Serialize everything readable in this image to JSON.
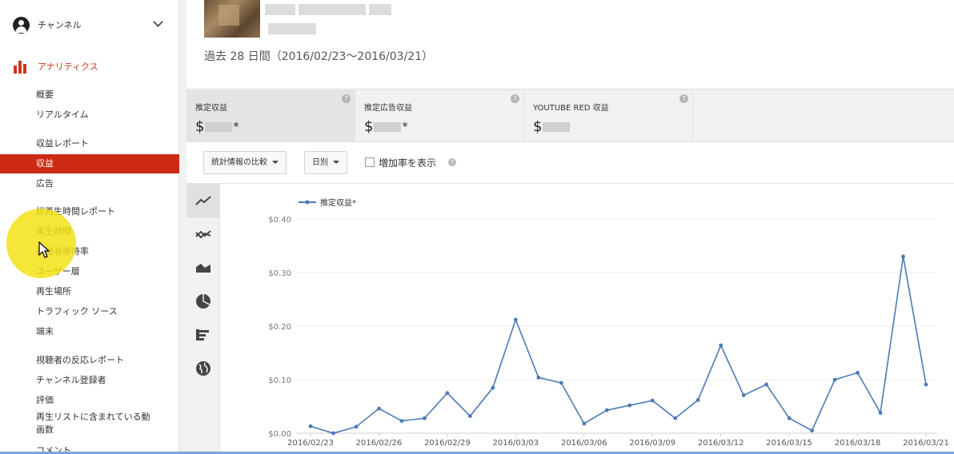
{
  "sidebar": {
    "channel_label": "チャンネル",
    "analytics_label": "アナリティクス",
    "items": [
      {
        "label": "概要",
        "name": "sidebar-item-overview"
      },
      {
        "label": "リアルタイム",
        "name": "sidebar-item-realtime"
      },
      {
        "label": "収益レポート",
        "name": "sidebar-item-revenue-reports"
      },
      {
        "label": "収益",
        "name": "sidebar-item-revenue"
      },
      {
        "label": "広告",
        "name": "sidebar-item-ads"
      },
      {
        "label": "総再生時間レポート",
        "name": "sidebar-item-watch-time-reports"
      },
      {
        "label": "再生時間",
        "name": "sidebar-item-watch-time"
      },
      {
        "label": "視聴者維持率",
        "name": "sidebar-item-audience-retention"
      },
      {
        "label": "ユーザー層",
        "name": "sidebar-item-demographics"
      },
      {
        "label": "再生場所",
        "name": "sidebar-item-playback-locations"
      },
      {
        "label": "トラフィック ソース",
        "name": "sidebar-item-traffic-sources"
      },
      {
        "label": "端末",
        "name": "sidebar-item-devices"
      },
      {
        "label": "視聴者の反応レポート",
        "name": "sidebar-item-engagement-reports"
      },
      {
        "label": "チャンネル登録者",
        "name": "sidebar-item-subscribers"
      },
      {
        "label": "評価",
        "name": "sidebar-item-likes"
      },
      {
        "label": "再生リストに含まれている動画数",
        "name": "sidebar-item-videos-in-playlists"
      },
      {
        "label": "コメント",
        "name": "sidebar-item-comments"
      }
    ]
  },
  "header": {
    "period": "過去 28 日間（2016/02/23〜2016/03/21）"
  },
  "metrics": [
    {
      "title": "推定収益",
      "prefix": "$",
      "suffix": "*"
    },
    {
      "title": "推定広告収益",
      "prefix": "$",
      "suffix": "*"
    },
    {
      "title": "YOUTUBE RED 収益",
      "prefix": "$",
      "suffix": ""
    }
  ],
  "controls": {
    "compare_label": "統計情報の比較",
    "interval_label": "日別",
    "growth_label": "増加率を表示"
  },
  "colors": {
    "accent": "#cc2a12",
    "line": "#4a7ab7"
  },
  "chart_data": {
    "type": "line",
    "legend": "推定収益*",
    "x": [
      "2016/02/23",
      "2016/02/24",
      "2016/02/25",
      "2016/02/26",
      "2016/02/27",
      "2016/02/28",
      "2016/02/29",
      "2016/03/01",
      "2016/03/02",
      "2016/03/03",
      "2016/03/04",
      "2016/03/05",
      "2016/03/06",
      "2016/03/07",
      "2016/03/08",
      "2016/03/09",
      "2016/03/10",
      "2016/03/11",
      "2016/03/12",
      "2016/03/13",
      "2016/03/14",
      "2016/03/15",
      "2016/03/16",
      "2016/03/17",
      "2016/03/18",
      "2016/03/19",
      "2016/03/20",
      "2016/03/21"
    ],
    "values": [
      0.013,
      0.0,
      0.012,
      0.046,
      0.023,
      0.028,
      0.075,
      0.032,
      0.085,
      0.212,
      0.104,
      0.094,
      0.018,
      0.043,
      0.052,
      0.061,
      0.028,
      0.062,
      0.164,
      0.071,
      0.091,
      0.028,
      0.005,
      0.1,
      0.113,
      0.038,
      0.33,
      0.091
    ],
    "tick_labels": [
      "2016/02/23",
      "2016/02/26",
      "2016/02/29",
      "2016/03/03",
      "2016/03/06",
      "2016/03/09",
      "2016/03/12",
      "2016/03/15",
      "2016/03/18",
      "2016/03/21"
    ],
    "y_ticks": [
      "$0.00",
      "$0.10",
      "$0.20",
      "$0.30",
      "$0.40"
    ],
    "ylim": [
      0,
      0.4
    ],
    "grid": true,
    "legend_position": "top-left"
  }
}
